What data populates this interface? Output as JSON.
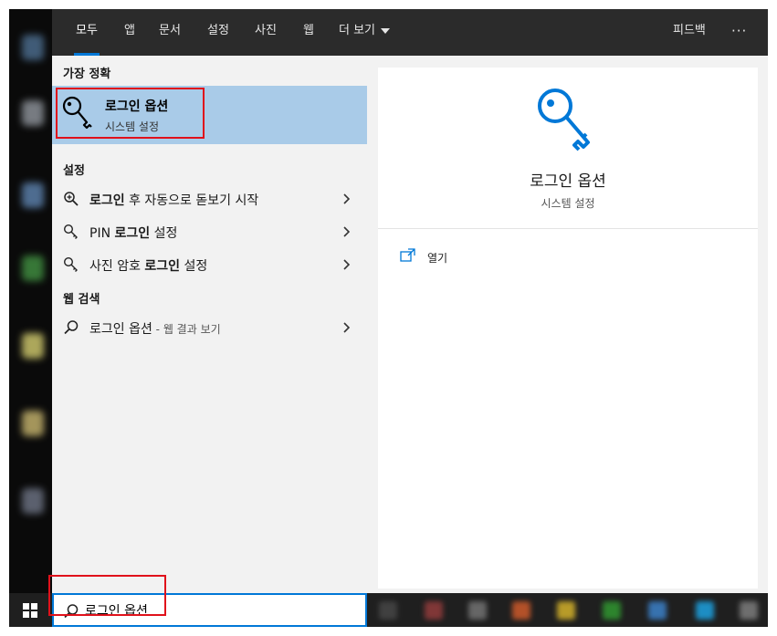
{
  "topbar": {
    "tabs": [
      {
        "label": "모두",
        "active": true
      },
      {
        "label": "앱"
      },
      {
        "label": "문서"
      },
      {
        "label": "설정"
      },
      {
        "label": "사진"
      },
      {
        "label": "웹"
      },
      {
        "label": "더 보기"
      }
    ],
    "feedback_label": "피드백",
    "more_label": "···"
  },
  "results": {
    "best_match_header": "가장 정확",
    "best_match": {
      "title": "로그인 옵션",
      "subtitle": "시스템 설정",
      "icon": "key-icon"
    },
    "settings_header": "설정",
    "settings_items": [
      {
        "bold": "로그인",
        "rest": " 후 자동으로 돋보기 시작",
        "icon": "magnifier-plus-icon"
      },
      {
        "prefix": "PIN ",
        "bold": "로그인",
        "rest": " 설정",
        "icon": "key-icon"
      },
      {
        "prefix": "사진 암호 ",
        "bold": "로그인",
        "rest": " 설정",
        "icon": "key-icon"
      }
    ],
    "web_header": "웹 검색",
    "web_item": {
      "text": "로그인 옵션",
      "suffix": " - 웹 결과 보기",
      "icon": "search-icon"
    }
  },
  "preview": {
    "title": "로그인 옵션",
    "subtitle": "시스템 설정",
    "action_open": "열기",
    "accent": "#0078d7"
  },
  "search": {
    "value": "로그인 옵션"
  },
  "colors": {
    "highlight": "#a9cbe8",
    "accent": "#0078d7",
    "annotation": "#e0111b",
    "topbar": "#2b2b2b",
    "panel": "#f2f2f2"
  }
}
